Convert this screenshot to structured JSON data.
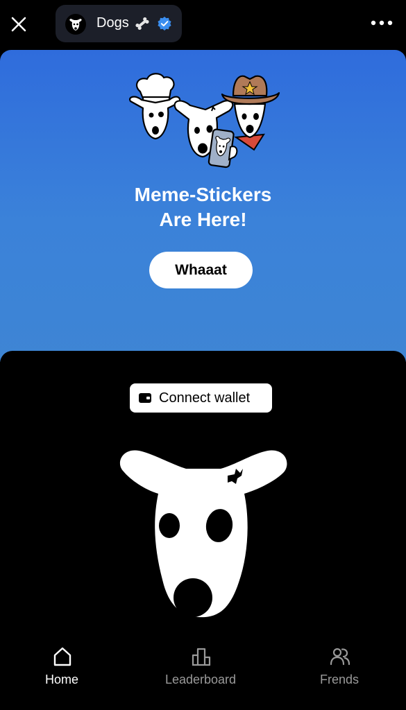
{
  "header": {
    "title": "Dogs",
    "icons": [
      "close-icon",
      "dog-avatar-icon",
      "bone-icon",
      "verified-badge-icon",
      "more-icon"
    ]
  },
  "banner": {
    "title_line1": "Meme-Stickers",
    "title_line2": "Are Here!",
    "button_label": "Whaaat",
    "gradient_colors": [
      "#2f6cdc",
      "#3e85d4"
    ]
  },
  "wallet": {
    "button_label": "Connect wallet",
    "icon": "wallet-icon"
  },
  "nav": {
    "items": [
      {
        "label": "Home",
        "icon": "home-icon",
        "active": true
      },
      {
        "label": "Leaderboard",
        "icon": "leaderboard-icon",
        "active": false
      },
      {
        "label": "Frends",
        "icon": "friends-icon",
        "active": false
      }
    ]
  },
  "colors": {
    "background": "#000000",
    "pill": "#1c1f29",
    "verified": "#3a8ef0",
    "inactive_nav": "#9a9a9a"
  }
}
